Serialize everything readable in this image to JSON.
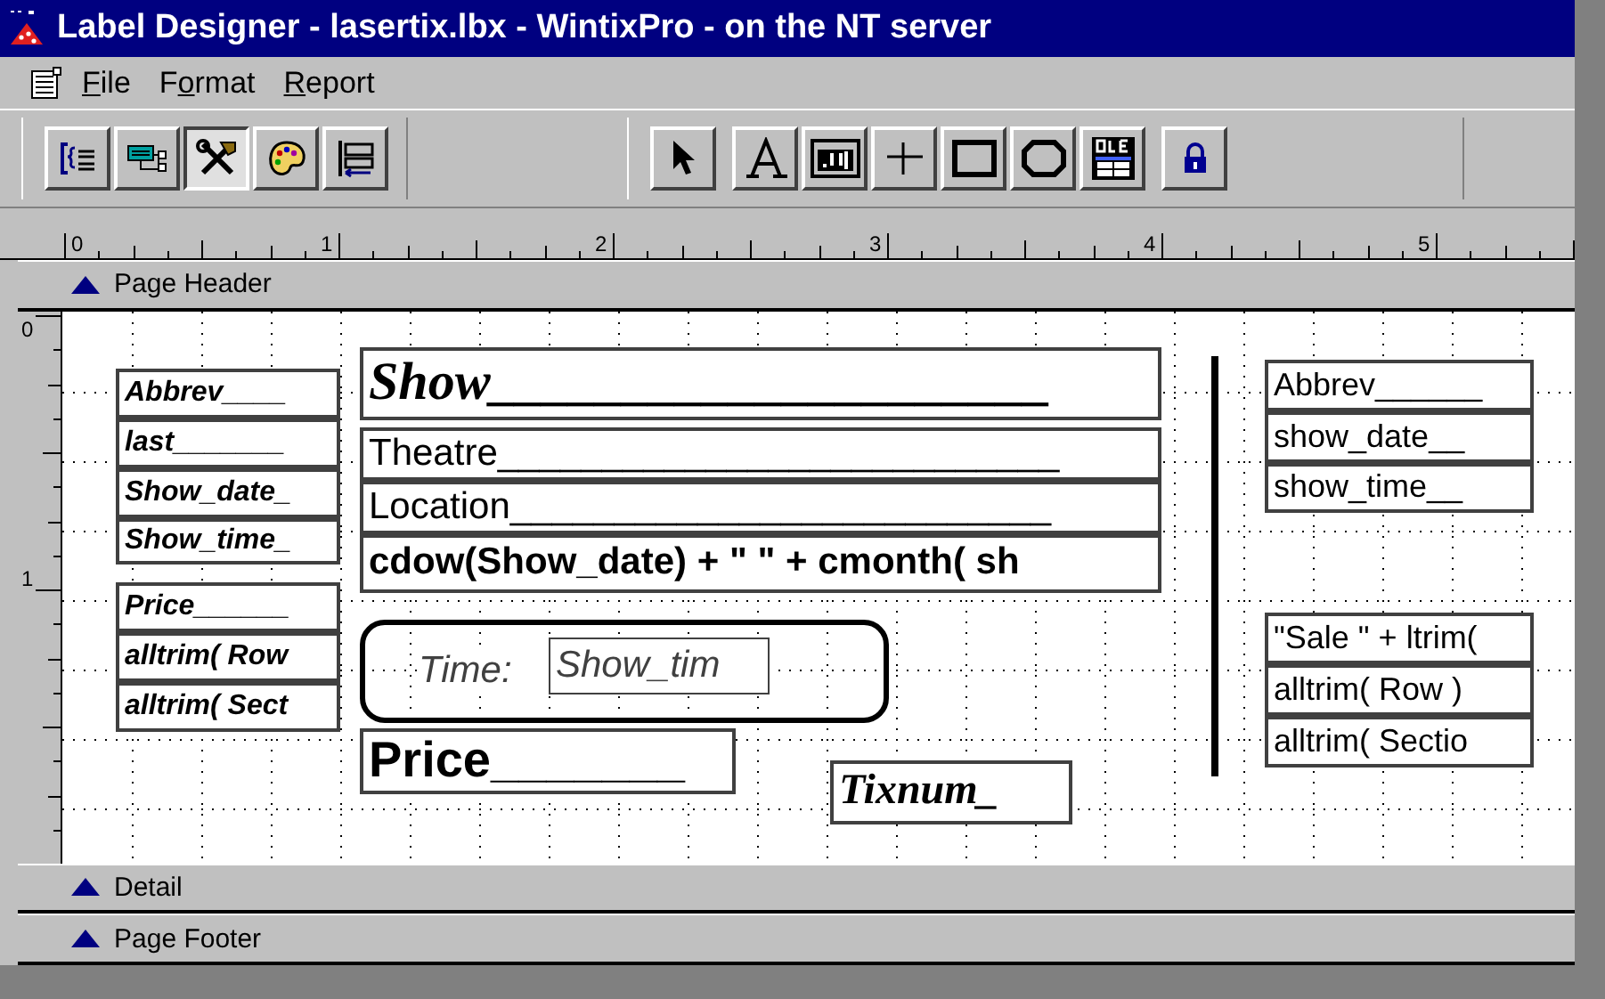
{
  "window": {
    "title": "Label Designer - lasertix.lbx - WintixPro - on the NT server"
  },
  "menu": [
    {
      "label": "File"
    },
    {
      "label": "Format"
    },
    {
      "label": "Report"
    }
  ],
  "toolbars": [
    [
      {
        "kind": "data-grouping",
        "pressed": false
      },
      {
        "kind": "data-environment",
        "pressed": false
      },
      {
        "kind": "tools",
        "pressed": true
      },
      {
        "kind": "palette",
        "pressed": false
      },
      {
        "kind": "layout",
        "pressed": false
      }
    ],
    [
      {
        "kind": "pointer",
        "pressed": false
      },
      {
        "kind": "label",
        "pressed": false
      },
      {
        "kind": "field",
        "pressed": false
      },
      {
        "kind": "line",
        "pressed": false
      },
      {
        "kind": "rectangle",
        "pressed": false
      },
      {
        "kind": "rounded-rectangle",
        "pressed": false
      },
      {
        "kind": "ole",
        "pressed": false
      },
      {
        "kind": "lock",
        "pressed": false
      }
    ]
  ],
  "ruler": {
    "labels": [
      "0",
      "1",
      "2",
      "3",
      "4",
      "5"
    ]
  },
  "vertical_ruler": {
    "labels": [
      "0",
      "1"
    ]
  },
  "bands": [
    {
      "label": "Page Header"
    },
    {
      "label": "Detail"
    },
    {
      "label": "Page Footer"
    }
  ],
  "objects": [
    {
      "kind": "field",
      "text": "Abbrev____"
    },
    {
      "kind": "field",
      "text": "last_______"
    },
    {
      "kind": "field",
      "text": "Show_date_"
    },
    {
      "kind": "field",
      "text": "Show_time_"
    },
    {
      "kind": "field",
      "text": "Price______"
    },
    {
      "kind": "field",
      "text": "alltrim( Row"
    },
    {
      "kind": "field",
      "text": "alltrim( Sect"
    },
    {
      "kind": "field",
      "text": "Show_____________________"
    },
    {
      "kind": "field",
      "text": "Theatre___________________________"
    },
    {
      "kind": "field",
      "text": " Location__________________________"
    },
    {
      "kind": "field",
      "text": "cdow(Show_date) + \" \" + cmonth( sh"
    },
    {
      "kind": "rounded-rectangle"
    },
    {
      "kind": "label",
      "text": "Time:"
    },
    {
      "kind": "field",
      "text": "Show_tim"
    },
    {
      "kind": "field",
      "text": "Price_______"
    },
    {
      "kind": "field",
      "text": "Tixnum_"
    },
    {
      "kind": "line"
    },
    {
      "kind": "field",
      "text": "Abbrev______"
    },
    {
      "kind": "field",
      "text": "show_date__"
    },
    {
      "kind": "field",
      "text": "show_time__"
    },
    {
      "kind": "field",
      "text": "\"Sale \" + ltrim("
    },
    {
      "kind": "field",
      "text": "alltrim( Row )"
    },
    {
      "kind": "field",
      "text": "alltrim( Sectio"
    }
  ]
}
